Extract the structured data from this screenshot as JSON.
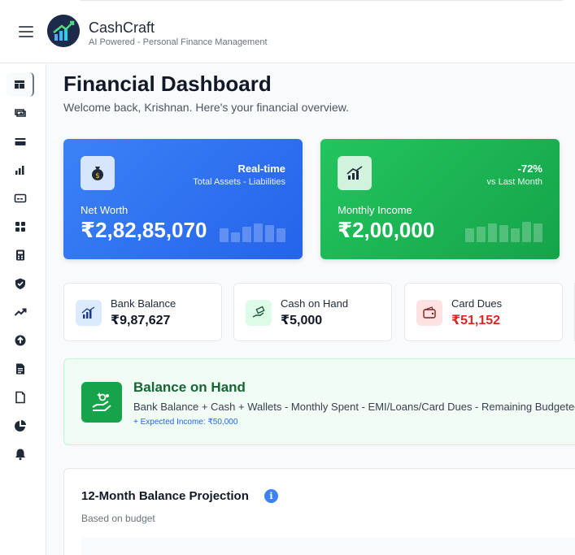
{
  "app": {
    "name": "CashCraft",
    "tagline": "AI Powered - Personal Finance Management"
  },
  "sidebar": {
    "items": [
      {
        "icon": "dashboard-icon"
      },
      {
        "icon": "money-icon"
      },
      {
        "icon": "credit-card-icon"
      },
      {
        "icon": "bar-chart-icon"
      },
      {
        "icon": "wallet-card-icon"
      },
      {
        "icon": "grid-icon"
      },
      {
        "icon": "calculator-icon"
      },
      {
        "icon": "shield-icon"
      },
      {
        "icon": "trending-up-icon"
      },
      {
        "icon": "upload-icon"
      },
      {
        "icon": "document-icon"
      },
      {
        "icon": "file-icon"
      },
      {
        "icon": "pie-chart-icon"
      },
      {
        "icon": "bell-icon"
      }
    ],
    "active_index": 0
  },
  "page": {
    "title": "Financial Dashboard",
    "subtitle": "Welcome back, Krishnan. Here's your financial overview."
  },
  "net_worth": {
    "badge": "Real-time",
    "badge_sub": "Total Assets - Liabilities",
    "label": "Net Worth",
    "amount": "₹2,82,85,070",
    "icon": "money-bag-icon",
    "color": "#3b82f6"
  },
  "monthly_income": {
    "badge": "-72%",
    "badge_sub": "vs Last Month",
    "label": "Monthly Income",
    "amount": "₹2,00,000",
    "icon": "growth-chart-icon",
    "color": "#22c55e"
  },
  "summary_cards": [
    {
      "label": "Bank Balance",
      "amount": "₹9,87,627",
      "icon": "bank-chart-icon",
      "accent": "#3b82f6"
    },
    {
      "label": "Cash on Hand",
      "amount": "₹5,000",
      "icon": "hand-cash-icon",
      "accent": "#16a34a"
    },
    {
      "label": "Card Dues",
      "amount": "₹51,152",
      "icon": "wallet-icon",
      "accent": "#dc2626"
    }
  ],
  "balance_on_hand": {
    "title": "Balance on Hand",
    "formula": "Bank Balance + Cash + Wallets - Monthly Spent - EMI/Loans/Card Dues - Remaining Budgeted Expe",
    "expected_income": "+ Expected Income: ₹50,000",
    "icon": "hand-coins-icon"
  },
  "projection": {
    "title": "12-Month Balance Projection",
    "subtitle": "Based on budget",
    "info_glyph": "i"
  }
}
